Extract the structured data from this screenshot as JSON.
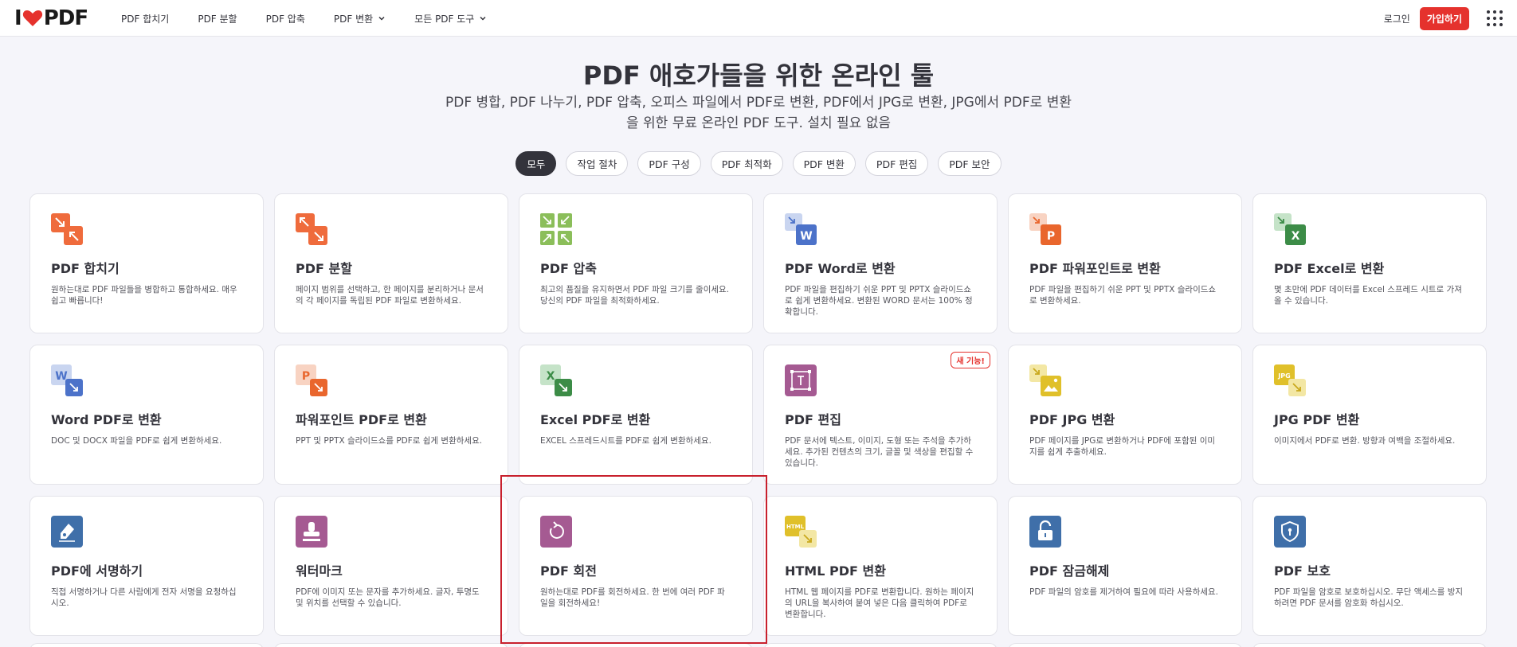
{
  "brand": {
    "logo_left": "I",
    "logo_right": "PDF",
    "logo_heart_icon": "heart-icon"
  },
  "nav": {
    "items": [
      {
        "label": "PDF 합치기",
        "dropdown": false
      },
      {
        "label": "PDF 분할",
        "dropdown": false
      },
      {
        "label": "PDF 압축",
        "dropdown": false
      },
      {
        "label": "PDF 변환",
        "dropdown": true
      },
      {
        "label": "모든 PDF 도구",
        "dropdown": true
      }
    ],
    "login": "로그인",
    "signup": "가입하기",
    "apps_icon": "grid-menu-icon"
  },
  "hero": {
    "title": "PDF 애호가들을 위한 온라인 툴",
    "subtitle": "PDF 병합, PDF 나누기, PDF 압축, 오피스 파일에서 PDF로 변환, PDF에서 JPG로 변환, JPG에서 PDF로 변환을 위한 무료 온라인 PDF 도구. 설치 필요 없음"
  },
  "filters": [
    {
      "label": "모두",
      "active": true
    },
    {
      "label": "작업 절차",
      "active": false
    },
    {
      "label": "PDF 구성",
      "active": false
    },
    {
      "label": "PDF 최적화",
      "active": false
    },
    {
      "label": "PDF 변환",
      "active": false
    },
    {
      "label": "PDF 편집",
      "active": false
    },
    {
      "label": "PDF 보안",
      "active": false
    }
  ],
  "tools": [
    {
      "title": "PDF 합치기",
      "desc": "원하는대로 PDF 파일들을 병합하고 통합하세요. 매우 쉽고 빠릅니다!",
      "icon": "merge-icon"
    },
    {
      "title": "PDF 분할",
      "desc": "페이지 범위를 선택하고, 한 페이지를 분리하거나 문서의 각 페이지를 독립된 PDF 파일로 변환하세요.",
      "icon": "split-icon"
    },
    {
      "title": "PDF 압축",
      "desc": "최고의 품질을 유지하면서 PDF 파일 크기를 줄이세요. 당신의 PDF 파일을 최적화하세요.",
      "icon": "compress-icon"
    },
    {
      "title": "PDF Word로 변환",
      "desc": "PDF 파일을 편집하기 쉬운 PPT 및 PPTX 슬라이드쇼로 쉽게 변환하세요. 변환된 WORD 문서는 100% 정확합니다.",
      "icon": "pdf-to-word-icon"
    },
    {
      "title": "PDF 파워포인트로 변환",
      "desc": "PDF 파일을 편집하기 쉬운 PPT 및 PPTX 슬라이드쇼로 변환하세요.",
      "icon": "pdf-to-powerpoint-icon"
    },
    {
      "title": "PDF Excel로 변환",
      "desc": "몇 초만에 PDF 데이터를 Excel 스프레드 시트로 가져올 수 있습니다.",
      "icon": "pdf-to-excel-icon"
    },
    {
      "title": "Word PDF로 변환",
      "desc": "DOC 및 DOCX 파일을 PDF로 쉽게 변환하세요.",
      "icon": "word-to-pdf-icon"
    },
    {
      "title": "파워포인트 PDF로 변환",
      "desc": "PPT 및 PPTX 슬라이드쇼를 PDF로 쉽게 변환하세요.",
      "icon": "powerpoint-to-pdf-icon"
    },
    {
      "title": "Excel PDF로 변환",
      "desc": "EXCEL 스프레드시트를 PDF로 쉽게 변환하세요.",
      "icon": "excel-to-pdf-icon"
    },
    {
      "title": "PDF 편집",
      "desc": "PDF 문서에 텍스트, 이미지, 도형 또는 주석을 추가하세요. 추가된 컨텐츠의 크기, 글꼴 및 색상을 편집할 수 있습니다.",
      "icon": "edit-pdf-icon",
      "badge": "새 기능!"
    },
    {
      "title": "PDF JPG 변환",
      "desc": "PDF 페이지를 JPG로 변환하거나 PDF에 포함된 이미지를 쉽게 추출하세요.",
      "icon": "pdf-to-jpg-icon"
    },
    {
      "title": "JPG PDF 변환",
      "desc": "이미지에서 PDF로 변환. 방향과 여백을 조절하세요.",
      "icon": "jpg-to-pdf-icon"
    },
    {
      "title": "PDF에 서명하기",
      "desc": "직접 서명하거나 다른 사람에게 전자 서명을 요청하십시오.",
      "icon": "sign-icon"
    },
    {
      "title": "워터마크",
      "desc": "PDF에 이미지 또는 문자를 추가하세요. 글자, 투명도 및 위치를 선택할 수 있습니다.",
      "icon": "watermark-icon"
    },
    {
      "title": "PDF 회전",
      "desc": "원하는대로 PDF를 회전하세요. 한 번에 여러 PDF 파일을 회전하세요!",
      "icon": "rotate-icon"
    },
    {
      "title": "HTML PDF 변환",
      "desc": "HTML 웹 페이지를 PDF로 변환합니다. 원하는 페이지의 URL을 복사하여 붙여 넣은 다음 클릭하여 PDF로 변환합니다.",
      "icon": "html-to-pdf-icon"
    },
    {
      "title": "PDF 잠금해제",
      "desc": "PDF 파일의 암호를 제거하여 필요에 따라 사용하세요.",
      "icon": "unlock-icon"
    },
    {
      "title": "PDF 보호",
      "desc": "PDF 파일을 암호로 보호하십시오. 무단 액세스를 방지하려면 PDF 문서를 암호화 하십시오.",
      "icon": "protect-icon"
    }
  ],
  "colors": {
    "accent": "#e5322d",
    "organize": "#ef6b3c",
    "compress": "#8bbe5a",
    "word": "#4c72c9",
    "powerpoint": "#e9662d",
    "excel": "#3c8c47",
    "edit_purple": "#a55a92",
    "jpg_yellow": "#e0c02a",
    "security_blue": "#3f6fa9"
  }
}
